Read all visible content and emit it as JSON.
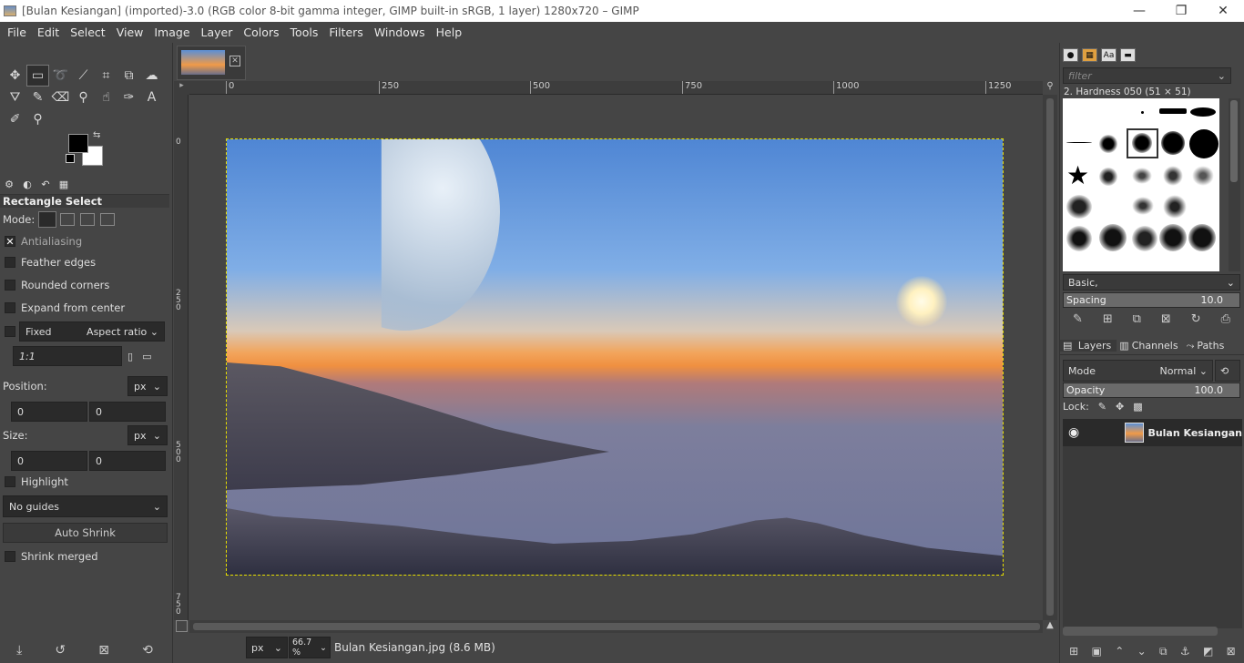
{
  "window": {
    "title": "[Bulan Kesiangan] (imported)-3.0 (RGB color 8-bit gamma integer, GIMP built-in sRGB, 1 layer) 1280x720 – GIMP",
    "min": "—",
    "max": "❐",
    "close": "✕"
  },
  "menu": [
    "File",
    "Edit",
    "Select",
    "View",
    "Image",
    "Layer",
    "Colors",
    "Tools",
    "Filters",
    "Windows",
    "Help"
  ],
  "tool_options": {
    "title": "Rectangle Select",
    "mode_label": "Mode:",
    "antialiasing": "Antialiasing",
    "feather": "Feather edges",
    "rounded": "Rounded corners",
    "expand": "Expand from center",
    "fixed": "Fixed",
    "aspect": "Aspect ratio",
    "ratio_value": "1:1",
    "position_label": "Position:",
    "position_unit": "px",
    "pos_x": "0",
    "pos_y": "0",
    "size_label": "Size:",
    "size_unit": "px",
    "size_x": "0",
    "size_y": "0",
    "highlight": "Highlight",
    "guides": "No guides",
    "auto_shrink": "Auto Shrink",
    "shrink_merged": "Shrink merged"
  },
  "ruler": {
    "h": [
      "0",
      "250",
      "500",
      "750",
      "1000",
      "1250"
    ],
    "v": [
      "0",
      "250",
      "500",
      "750"
    ]
  },
  "status": {
    "unit": "px",
    "zoom": "66.7 %",
    "file": "Bulan Kesiangan.jpg (8.6 MB)"
  },
  "brushes": {
    "filter_placeholder": "filter",
    "current": "2. Hardness 050 (51 × 51)",
    "tag": "Basic,",
    "spacing_label": "Spacing",
    "spacing_value": "10.0"
  },
  "layers": {
    "tabs": [
      "Layers",
      "Channels",
      "Paths"
    ],
    "mode_label": "Mode",
    "mode_value": "Normal",
    "opacity_label": "Opacity",
    "opacity_value": "100.0",
    "lock_label": "Lock:",
    "layer_name": "Bulan Kesiangan"
  }
}
